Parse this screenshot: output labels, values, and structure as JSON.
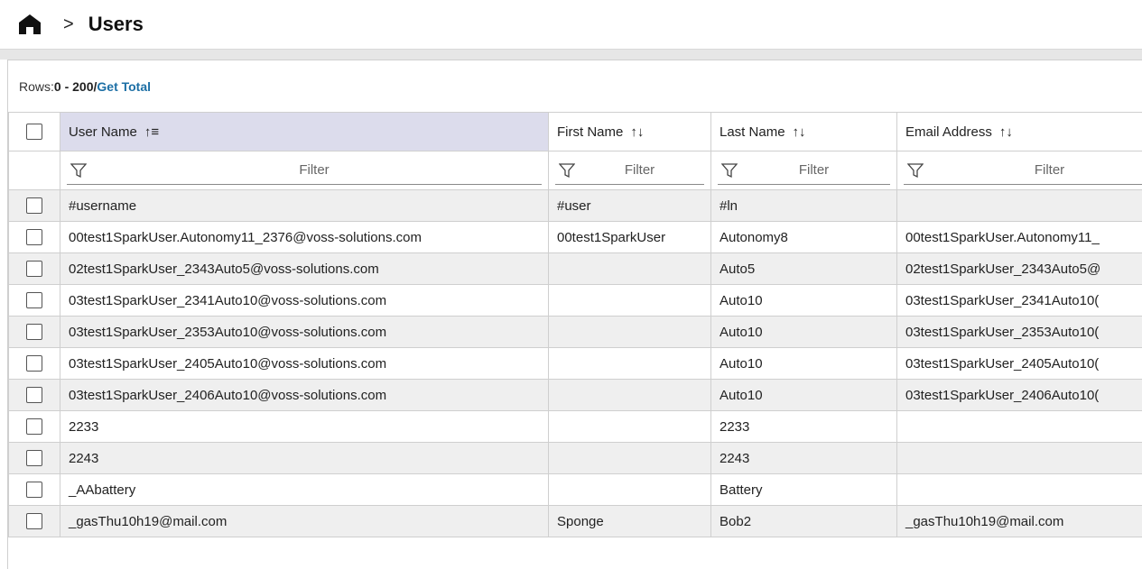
{
  "breadcrumb": {
    "home_icon": "home-icon",
    "separator": ">",
    "title": "Users"
  },
  "rows_bar": {
    "prefix": "Rows: ",
    "range": "0 - 200",
    "slash": " / ",
    "get_total": "Get Total"
  },
  "columns": [
    {
      "label": "User Name",
      "sort_icon": "↑≡"
    },
    {
      "label": "First Name",
      "sort_icon": "↑↓"
    },
    {
      "label": "Last Name",
      "sort_icon": "↑↓"
    },
    {
      "label": "Email Address",
      "sort_icon": "↑↓"
    }
  ],
  "filter_placeholder": "Filter",
  "rows": [
    {
      "username": "#username",
      "first": "#user",
      "last": "#ln",
      "email": ""
    },
    {
      "username": "00test1SparkUser.Autonomy11_2376@voss-solutions.com",
      "first": "00test1SparkUser",
      "last": "Autonomy8",
      "email": "00test1SparkUser.Autonomy11_"
    },
    {
      "username": "02test1SparkUser_2343Auto5@voss-solutions.com",
      "first": "",
      "last": "Auto5",
      "email": "02test1SparkUser_2343Auto5@"
    },
    {
      "username": "03test1SparkUser_2341Auto10@voss-solutions.com",
      "first": "",
      "last": "Auto10",
      "email": "03test1SparkUser_2341Auto10("
    },
    {
      "username": "03test1SparkUser_2353Auto10@voss-solutions.com",
      "first": "",
      "last": "Auto10",
      "email": "03test1SparkUser_2353Auto10("
    },
    {
      "username": "03test1SparkUser_2405Auto10@voss-solutions.com",
      "first": "",
      "last": "Auto10",
      "email": "03test1SparkUser_2405Auto10("
    },
    {
      "username": "03test1SparkUser_2406Auto10@voss-solutions.com",
      "first": "",
      "last": "Auto10",
      "email": "03test1SparkUser_2406Auto10("
    },
    {
      "username": "2233",
      "first": "",
      "last": "2233",
      "email": ""
    },
    {
      "username": "2243",
      "first": "",
      "last": "2243",
      "email": ""
    },
    {
      "username": "_AAbattery",
      "first": "",
      "last": "Battery",
      "email": ""
    },
    {
      "username": "_gasThu10h19@mail.com",
      "first": "Sponge",
      "last": "Bob2",
      "email": "_gasThu10h19@mail.com"
    }
  ],
  "colors": {
    "sorted_header_bg": "#dcdcec",
    "link": "#1d6fa5",
    "stripe": "#efefef"
  }
}
